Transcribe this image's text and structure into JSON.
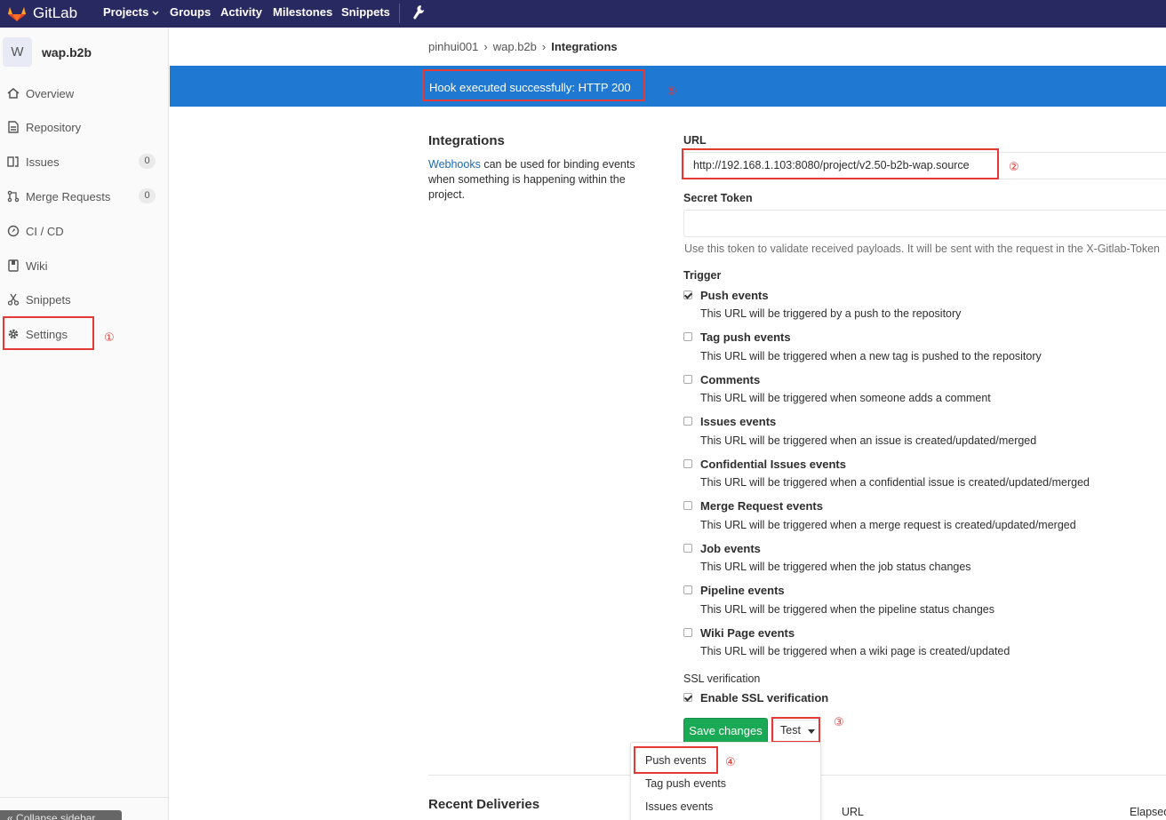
{
  "colors": {
    "topbar": "#292961",
    "flash": "#1f78d1",
    "save": "#1aaa55",
    "marker": "#e53935"
  },
  "topbar": {
    "brand": "GitLab",
    "nav": [
      "Projects",
      "Groups",
      "Activity",
      "Milestones",
      "Snippets"
    ],
    "icons": [
      "gitlab-logo-icon",
      "chevron-down-icon",
      "wrench-icon"
    ]
  },
  "sidebar": {
    "avatar_letter": "W",
    "project_name": "wap.b2b",
    "items": [
      {
        "label": "Overview",
        "icon": "home-icon"
      },
      {
        "label": "Repository",
        "icon": "doc-icon"
      },
      {
        "label": "Issues",
        "icon": "issues-icon",
        "badge": "0"
      },
      {
        "label": "Merge Requests",
        "icon": "merge-icon",
        "badge": "0"
      },
      {
        "label": "CI / CD",
        "icon": "rocket-icon"
      },
      {
        "label": "Wiki",
        "icon": "book-icon"
      },
      {
        "label": "Snippets",
        "icon": "scissors-icon"
      },
      {
        "label": "Settings",
        "icon": "gear-icon"
      }
    ],
    "collapse_label": "Collapse sidebar"
  },
  "markers": {
    "m1": "①",
    "m2": "②",
    "m3": "③",
    "m4": "④",
    "m5": "⑤"
  },
  "breadcrumb": {
    "group": "pinhui001",
    "project": "wap.b2b",
    "current": "Integrations"
  },
  "flash": {
    "message": "Hook executed successfully: HTTP 200"
  },
  "intro": {
    "title": "Integrations",
    "link": "Webhooks",
    "text": " can be used for binding events when something is happening within the project."
  },
  "form": {
    "url_label": "URL",
    "url_value": "http://192.168.1.103:8080/project/v2.50-b2b-wap.source",
    "token_label": "Secret Token",
    "token_value": "",
    "token_help": "Use this token to validate received payloads. It will be sent with the request in the X-Gitlab-Token",
    "trigger_label": "Trigger",
    "events": [
      {
        "name": "Push events",
        "desc": "This URL will be triggered by a push to the repository",
        "checked": true
      },
      {
        "name": "Tag push events",
        "desc": "This URL will be triggered when a new tag is pushed to the repository",
        "checked": false
      },
      {
        "name": "Comments",
        "desc": "This URL will be triggered when someone adds a comment",
        "checked": false
      },
      {
        "name": "Issues events",
        "desc": "This URL will be triggered when an issue is created/updated/merged",
        "checked": false
      },
      {
        "name": "Confidential Issues events",
        "desc": "This URL will be triggered when a confidential issue is created/updated/merged",
        "checked": false
      },
      {
        "name": "Merge Request events",
        "desc": "This URL will be triggered when a merge request is created/updated/merged",
        "checked": false
      },
      {
        "name": "Job events",
        "desc": "This URL will be triggered when the job status changes",
        "checked": false
      },
      {
        "name": "Pipeline events",
        "desc": "This URL will be triggered when the pipeline status changes",
        "checked": false
      },
      {
        "name": "Wiki Page events",
        "desc": "This URL will be triggered when a wiki page is created/updated",
        "checked": false
      }
    ],
    "ssl_label": "SSL verification",
    "ssl_option": "Enable SSL verification",
    "ssl_checked": true,
    "save_label": "Save changes",
    "test_label": "Test"
  },
  "test_menu": [
    "Push events",
    "Tag push events",
    "Issues events"
  ],
  "recent": {
    "title": "Recent Deliveries",
    "columns": [
      "URL",
      "Elapsed"
    ]
  }
}
